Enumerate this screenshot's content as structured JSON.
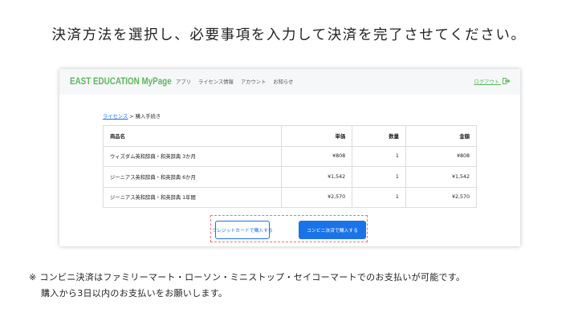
{
  "headline": "決済方法を選択し、必要事項を入力して決済を完了させてください。",
  "navbar": {
    "brand": "EAST EDUCATION  MyPage",
    "links": [
      "アプリ",
      "ライセンス情報",
      "アカウント",
      "お知らせ"
    ],
    "logout": "ログアウト",
    "accent_color": "#5cb85c"
  },
  "breadcrumb": {
    "link": "ライセンス",
    "separator": " > ",
    "current": "購入手続き"
  },
  "table": {
    "headers": [
      "商品名",
      "単価",
      "数量",
      "金額"
    ],
    "rows": [
      [
        "ウィズダム英和辞典・和英辞典 3か月",
        "¥808",
        "1",
        "¥808"
      ],
      [
        "ジーニアス英和辞典・和英辞典 6か月",
        "¥1,542",
        "1",
        "¥1,542"
      ],
      [
        "ジーニアス英和辞典・和英辞典 1年間",
        "¥2,570",
        "1",
        "¥2,570"
      ]
    ]
  },
  "buttons": {
    "credit": "クレジットカードで購入する",
    "convenience": "コンビニ決済で購入する",
    "primary_color": "#1a73e8",
    "highlight_color": "#f06f80"
  },
  "notes": {
    "line1": "※ コンビニ決済はファミリーマート・ローソン・ミニストップ・セイコーマートでのお支払いが可能です。",
    "line2": "購入から3日以内のお支払いをお願いします。"
  },
  "icons": {
    "logout": "logout-icon"
  }
}
